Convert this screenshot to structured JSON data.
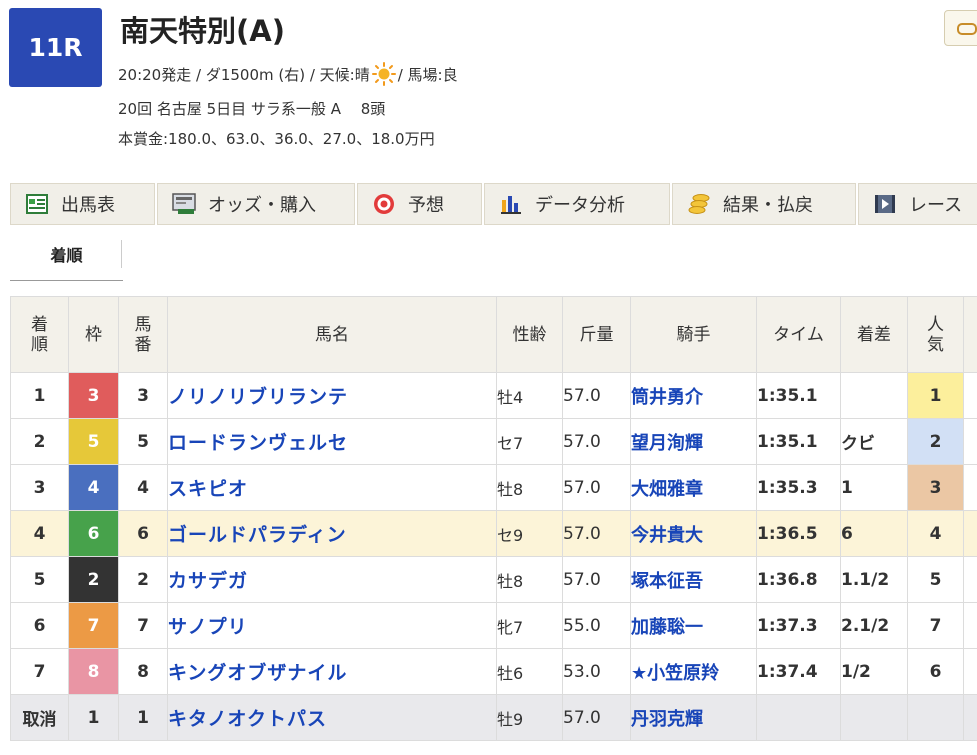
{
  "race": {
    "number": "11R",
    "title": "南天特別(A)",
    "info_before_weather_icon": "20:20発走 / ダ1500m (右) / 天候:晴",
    "info_after_weather_icon": " / 馬場:良",
    "weather_icon": "sun-icon",
    "meeting_line": "20回 名古屋 5日目 サラ系一般 A 　8頭",
    "prize_line": "本賞金:180.0、63.0、36.0、27.0、18.0万円"
  },
  "tabs": [
    {
      "label": "出馬表",
      "icon": "entry-table-icon"
    },
    {
      "label": "オッズ・購入",
      "icon": "ipat-icon"
    },
    {
      "label": "予想",
      "icon": "target-icon"
    },
    {
      "label": "データ分析",
      "icon": "bar-chart-icon"
    },
    {
      "label": "結果・払戻",
      "icon": "coins-icon"
    },
    {
      "label": "レース",
      "icon": "video-icon"
    }
  ],
  "subtab": {
    "label": "着順"
  },
  "table": {
    "headers": {
      "finish": "着\n順",
      "frame": "枠",
      "horse_no": "馬\n番",
      "horse_name": "馬名",
      "sex_age": "性齢",
      "weight": "斤量",
      "jockey": "騎手",
      "time": "タイム",
      "margin": "着差",
      "popularity": "人\n気"
    },
    "rows": [
      {
        "finish": "1",
        "frame": "3",
        "frame_color": "#e05c5c",
        "horse_no": "3",
        "horse": "ノリノリブリランテ",
        "sex_age": "牡4",
        "weight": "57.0",
        "jockey": "筒井勇介",
        "time": "1:35.1",
        "margin": "",
        "pop": "1",
        "pop_color": "#fcef9c"
      },
      {
        "finish": "2",
        "frame": "5",
        "frame_color": "#e6c839",
        "horse_no": "5",
        "horse": "ロードランヴェルセ",
        "sex_age": "セ7",
        "weight": "57.0",
        "jockey": "望月洵輝",
        "time": "1:35.1",
        "margin": "クビ",
        "pop": "2",
        "pop_color": "#d2e0f5"
      },
      {
        "finish": "3",
        "frame": "4",
        "frame_color": "#4a6fbf",
        "horse_no": "4",
        "horse": "スキピオ",
        "sex_age": "牡8",
        "weight": "57.0",
        "jockey": "大畑雅章",
        "time": "1:35.3",
        "margin": "1",
        "pop": "3",
        "pop_color": "#ebc7a4"
      },
      {
        "finish": "4",
        "frame": "6",
        "frame_color": "#47a24b",
        "horse_no": "6",
        "horse": "ゴールドパラディン",
        "sex_age": "セ9",
        "weight": "57.0",
        "jockey": "今井貴大",
        "time": "1:36.5",
        "margin": "6",
        "pop": "4",
        "pop_color": ""
      },
      {
        "finish": "5",
        "frame": "2",
        "frame_color": "#333333",
        "horse_no": "2",
        "horse": "カサデガ",
        "sex_age": "牡8",
        "weight": "57.0",
        "jockey": "塚本征吾",
        "time": "1:36.8",
        "margin": "1.1/2",
        "pop": "5",
        "pop_color": ""
      },
      {
        "finish": "6",
        "frame": "7",
        "frame_color": "#ec9a45",
        "horse_no": "7",
        "horse": "サノプリ",
        "sex_age": "牝7",
        "weight": "55.0",
        "jockey": "加藤聡一",
        "time": "1:37.3",
        "margin": "2.1/2",
        "pop": "7",
        "pop_color": ""
      },
      {
        "finish": "7",
        "frame": "8",
        "frame_color": "#e995a4",
        "horse_no": "8",
        "horse": "キングオブザナイル",
        "sex_age": "牡6",
        "weight": "53.0",
        "jockey": "★小笠原羚",
        "time": "1:37.4",
        "margin": "1/2",
        "pop": "6",
        "pop_color": ""
      },
      {
        "finish": "取消",
        "frame": "1",
        "frame_color": "",
        "horse_no": "1",
        "horse": "キタノオクトパス",
        "sex_age": "牡9",
        "weight": "57.0",
        "jockey": "丹羽克輝",
        "time": "",
        "margin": "",
        "pop": "",
        "pop_color": ""
      }
    ]
  }
}
